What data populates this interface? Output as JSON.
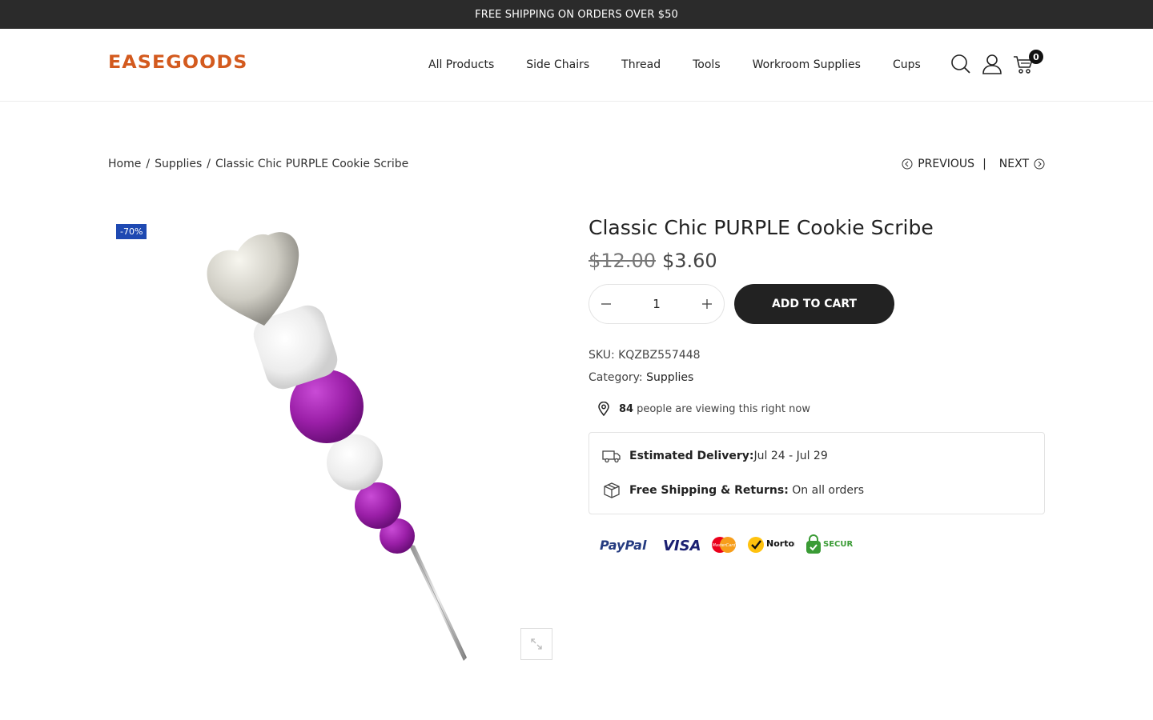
{
  "topbar": {
    "text": "FREE SHIPPING ON ORDERS OVER $50"
  },
  "logo": {
    "text": "EASEGOODS"
  },
  "nav": {
    "items": [
      "All Products",
      "Side Chairs",
      "Thread",
      "Tools",
      "Workroom Supplies",
      "Cups"
    ]
  },
  "header_icons": {
    "search": "search-icon",
    "account": "user-icon",
    "cart": "cart-icon",
    "cart_count": "0"
  },
  "breadcrumb": {
    "home": "Home",
    "sep": "/",
    "category": "Supplies",
    "current": "Classic Chic PURPLE Cookie Scribe"
  },
  "pager": {
    "previous": "PREVIOUS",
    "divider": "|",
    "next": "NEXT"
  },
  "product": {
    "sale_badge": "-70%",
    "title": "Classic Chic PURPLE Cookie Scribe",
    "old_price": "$12.00",
    "price": "$3.60",
    "quantity": "1",
    "add_to_cart": "ADD TO CART",
    "sku_label": "SKU:",
    "sku": "KQZBZ557448",
    "category_label": "Category:",
    "category": "Supplies",
    "viewing_count": "84",
    "viewing_text": "people are viewing this right now",
    "delivery_label": "Estimated Delivery:",
    "delivery_value": "Jul 24 - Jul 29",
    "shipping_label": "Free Shipping & Returns:",
    "shipping_value": "On all orders"
  },
  "payments": {
    "paypal": "PayPal",
    "visa": "VISA",
    "mastercard": "MasterCard",
    "norton": "Norton",
    "secure": "SECURE"
  },
  "colors": {
    "accent": "#d35a1e",
    "dark": "#222222",
    "sale": "#1e49b2",
    "purple": "#9b1fa8"
  }
}
